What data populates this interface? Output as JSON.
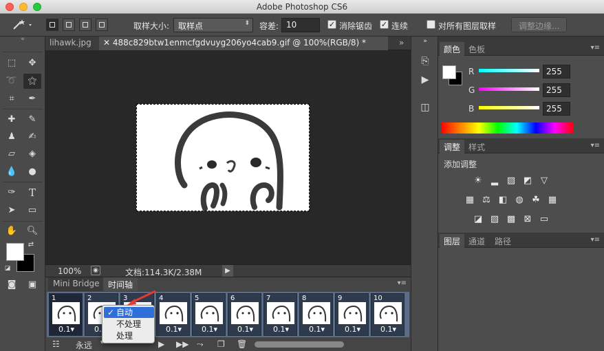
{
  "window": {
    "title": "Adobe Photoshop CS6"
  },
  "options_bar": {
    "sample_size_label": "取样大小:",
    "sample_size_value": "取样点",
    "tolerance_label": "容差:",
    "tolerance_value": "10",
    "antialias_label": "消除锯齿",
    "antialias_checked": true,
    "contiguous_label": "连续",
    "contiguous_checked": true,
    "sample_all_layers_label": "对所有图层取样",
    "sample_all_layers_checked": false,
    "refine_edge_label": "调整边缘..."
  },
  "document_tabs": [
    {
      "label": "lihawk.jpg",
      "active": false
    },
    {
      "label": "488c829btw1enmcfgdvuyg206yo4cab9.gif @ 100%(RGB/8) *",
      "active": true
    }
  ],
  "doc_tab_overflow": "»",
  "status_bar": {
    "zoom": "100%",
    "doc_info": "文档:114.3K/2.38M"
  },
  "timeline_panel": {
    "tabs": [
      {
        "label": "Mini Bridge",
        "active": false
      },
      {
        "label": "时间轴",
        "active": true
      }
    ],
    "frames": [
      {
        "number": "1",
        "delay": "0.1"
      },
      {
        "number": "2",
        "delay": "0.1"
      },
      {
        "number": "3",
        "delay": "0.1"
      },
      {
        "number": "4",
        "delay": "0.1"
      },
      {
        "number": "5",
        "delay": "0.1"
      },
      {
        "number": "6",
        "delay": "0.1"
      },
      {
        "number": "7",
        "delay": "0.1"
      },
      {
        "number": "8",
        "delay": "0.1"
      },
      {
        "number": "9",
        "delay": "0.1"
      },
      {
        "number": "10",
        "delay": "0.1"
      }
    ],
    "loop_value": "永远"
  },
  "disposal_menu": {
    "items": [
      {
        "label": "自动",
        "checked": true,
        "highlighted": true
      },
      {
        "label": "不处理",
        "checked": false,
        "highlighted": false
      },
      {
        "label": "处理",
        "checked": false,
        "highlighted": false
      }
    ]
  },
  "color_panel": {
    "tabs": [
      {
        "label": "颜色",
        "active": true
      },
      {
        "label": "色板",
        "active": false
      }
    ],
    "r_label": "R",
    "g_label": "G",
    "b_label": "B",
    "r_value": "255",
    "g_value": "255",
    "b_value": "255"
  },
  "adjustments_panel": {
    "tabs": [
      {
        "label": "调整",
        "active": true
      },
      {
        "label": "样式",
        "active": false
      }
    ],
    "heading": "添加调整"
  },
  "layers_panel": {
    "tabs": [
      {
        "label": "图层",
        "active": true
      },
      {
        "label": "通道",
        "active": false
      },
      {
        "label": "路径",
        "active": false
      }
    ]
  },
  "colors": {
    "foreground": "#ffffff",
    "background": "#000000",
    "menu_highlight": "#2f6fd9",
    "frame_strip": "#5b6d86"
  }
}
